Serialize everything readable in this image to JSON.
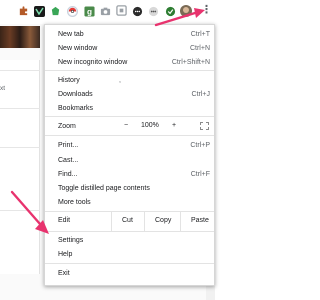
{
  "toolbar": {
    "extensions": [
      "puzzle-extension-icon",
      "dark-extension-icon",
      "green-extension-icon",
      "pokeball-extension-icon",
      "g-extension-icon",
      "camera-extension-icon",
      "square-extension-icon",
      "chat-extension-icon",
      "dots-extension-icon",
      "green-circle-extension-icon"
    ],
    "menu_button_glyph": "⋮"
  },
  "page": {
    "left_snippet": "xt"
  },
  "menu": {
    "new_tab": {
      "label": "New tab",
      "shortcut": "Ctrl+T"
    },
    "new_window": {
      "label": "New window",
      "shortcut": "Ctrl+N"
    },
    "new_incognito": {
      "label": "New incognito window",
      "shortcut": "Ctrl+Shift+N"
    },
    "history": {
      "label": "History",
      "extra": ","
    },
    "downloads": {
      "label": "Downloads",
      "shortcut": "Ctrl+J"
    },
    "bookmarks": {
      "label": "Bookmarks"
    },
    "zoom": {
      "label": "Zoom",
      "minus": "−",
      "value": "100%",
      "plus": "+"
    },
    "print": {
      "label": "Print...",
      "shortcut": "Ctrl+P"
    },
    "cast": {
      "label": "Cast..."
    },
    "find": {
      "label": "Find...",
      "shortcut": "Ctrl+F"
    },
    "toggle_distilled": {
      "label": "Toggle distilled page contents"
    },
    "more_tools": {
      "label": "More tools"
    },
    "edit": {
      "label": "Edit",
      "cut": "Cut",
      "copy": "Copy",
      "paste": "Paste"
    },
    "settings": {
      "label": "Settings"
    },
    "help": {
      "label": "Help"
    },
    "exit": {
      "label": "Exit"
    }
  },
  "colors": {
    "annotation_arrow": "#e8336e",
    "menu_bg": "#ffffff",
    "separator": "#e3e3e3"
  }
}
